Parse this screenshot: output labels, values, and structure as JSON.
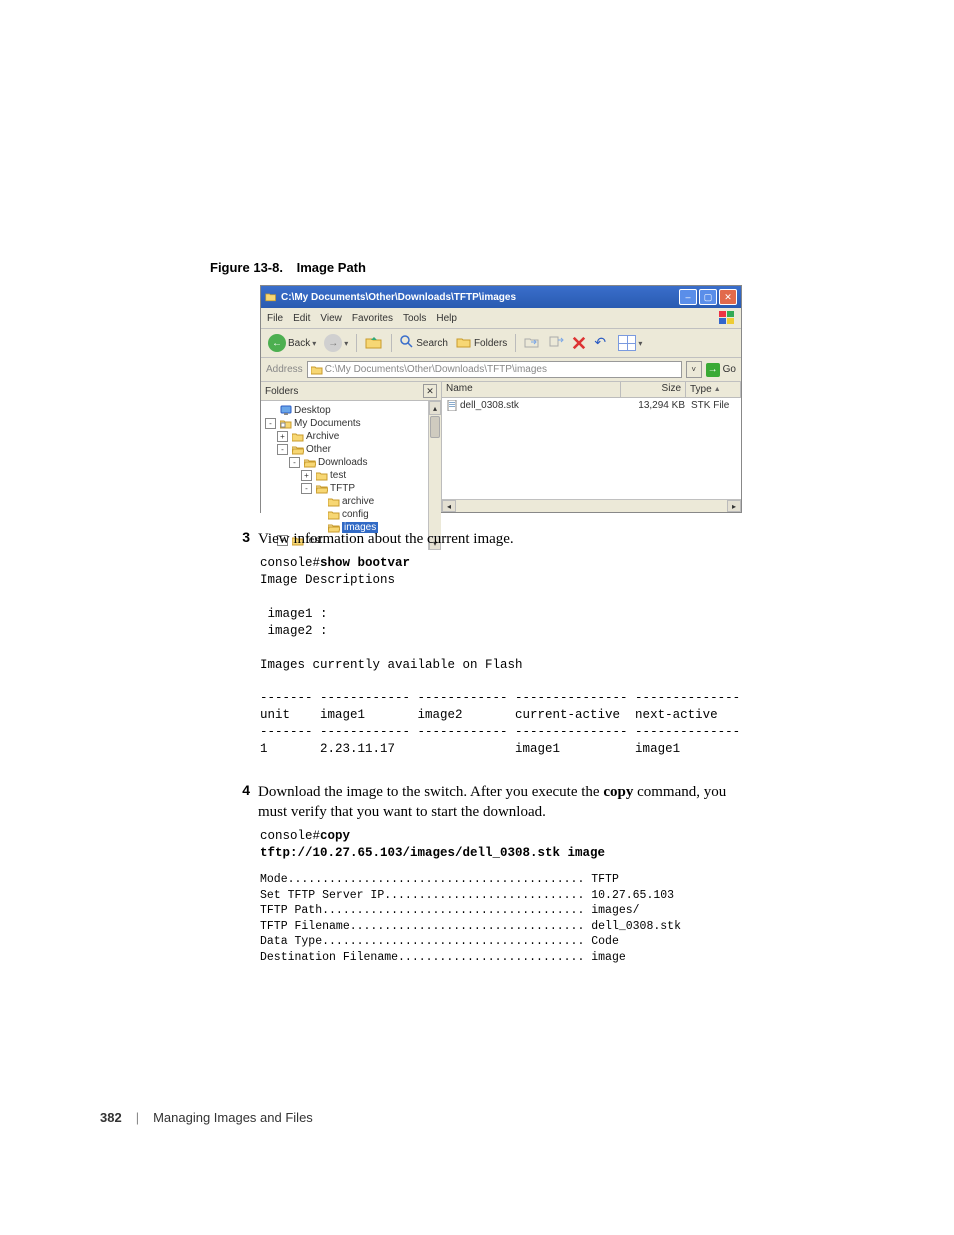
{
  "figure": {
    "number": "Figure 13-8.",
    "title": "Image Path"
  },
  "explorer": {
    "titlebar": "C:\\My Documents\\Other\\Downloads\\TFTP\\images",
    "menus": [
      "File",
      "Edit",
      "View",
      "Favorites",
      "Tools",
      "Help"
    ],
    "toolbar": {
      "back": "Back",
      "search": "Search",
      "folders": "Folders"
    },
    "address_label": "Address",
    "address_path": "C:\\My Documents\\Other\\Downloads\\TFTP\\images",
    "go": "Go",
    "left": {
      "title": "Folders",
      "tree": [
        {
          "depth": 0,
          "toggle": "",
          "icon": "desktop",
          "label": "Desktop"
        },
        {
          "depth": 0,
          "toggle": "-",
          "icon": "doc",
          "label": "My Documents"
        },
        {
          "depth": 1,
          "toggle": "+",
          "icon": "folder",
          "label": "Archive"
        },
        {
          "depth": 1,
          "toggle": "-",
          "icon": "folder-open",
          "label": "Other"
        },
        {
          "depth": 2,
          "toggle": "-",
          "icon": "folder-open",
          "label": "Downloads"
        },
        {
          "depth": 3,
          "toggle": "+",
          "icon": "folder",
          "label": "test"
        },
        {
          "depth": 3,
          "toggle": "-",
          "icon": "folder-open",
          "label": "TFTP"
        },
        {
          "depth": 4,
          "toggle": "",
          "icon": "folder",
          "label": "archive"
        },
        {
          "depth": 4,
          "toggle": "",
          "icon": "folder",
          "label": "config"
        },
        {
          "depth": 4,
          "toggle": "",
          "icon": "folder-open",
          "label": "images",
          "selected": true
        },
        {
          "depth": 1,
          "toggle": "+",
          "icon": "folder",
          "label": "test"
        }
      ]
    },
    "right": {
      "columns": {
        "name": "Name",
        "size": "Size",
        "type": "Type"
      },
      "rows": [
        {
          "name": "dell_0308.stk",
          "size": "13,294 KB",
          "type": "STK File"
        }
      ]
    }
  },
  "step3": {
    "num": "3",
    "text": "View information about the current image.",
    "pre1": "console#",
    "cmd1": "show bootvar",
    "pre2": "Image Descriptions\n\n image1 :\n image2 :\n\nImages currently available on Flash\n\n------- ------------ ------------ --------------- --------------\nunit    image1       image2       current-active  next-active\n------- ------------ ------------ --------------- --------------\n1       2.23.11.17                image1          image1"
  },
  "step4": {
    "num": "4",
    "text_a": "Download the image to the switch. After you execute the ",
    "cmd_inline": "copy",
    "text_b": " command, you must verify that you want to start the download.",
    "pre1": "console#",
    "cmd1": "copy\ntftp://10.27.65.103/images/dell_0308.stk image",
    "pre2": "Mode........................................... TFTP\nSet TFTP Server IP............................. 10.27.65.103\nTFTP Path...................................... images/\nTFTP Filename.................................. dell_0308.stk\nData Type...................................... Code\nDestination Filename........................... image"
  },
  "footer": {
    "page": "382",
    "chapter": "Managing Images and Files"
  }
}
